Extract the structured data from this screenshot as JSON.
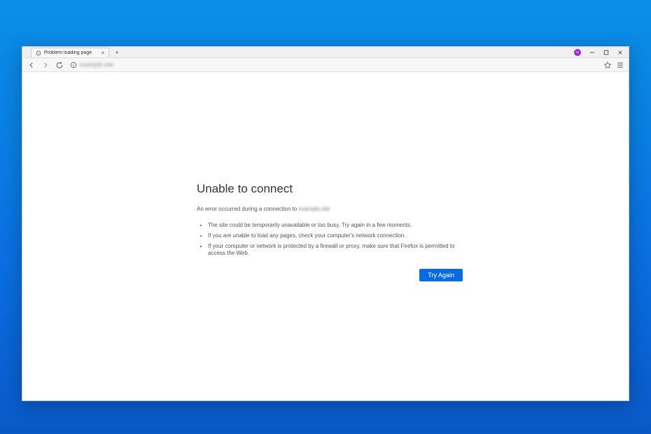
{
  "tab": {
    "title": "Problem loading page"
  },
  "profile": {
    "initials": "∞"
  },
  "address": {
    "host_blurred": "example.site"
  },
  "error": {
    "title": "Unable to connect",
    "subtitle_prefix": "An error occurred during a connection to ",
    "subtitle_host_blurred": "example.site",
    "bullets": [
      "The site could be temporarily unavailable or too busy. Try again in a few moments.",
      "If you are unable to load any pages, check your computer's network connection.",
      "If your computer or network is protected by a firewall or proxy, make sure that Firefox is permitted to access the Web."
    ],
    "try_again_label": "Try Again"
  }
}
